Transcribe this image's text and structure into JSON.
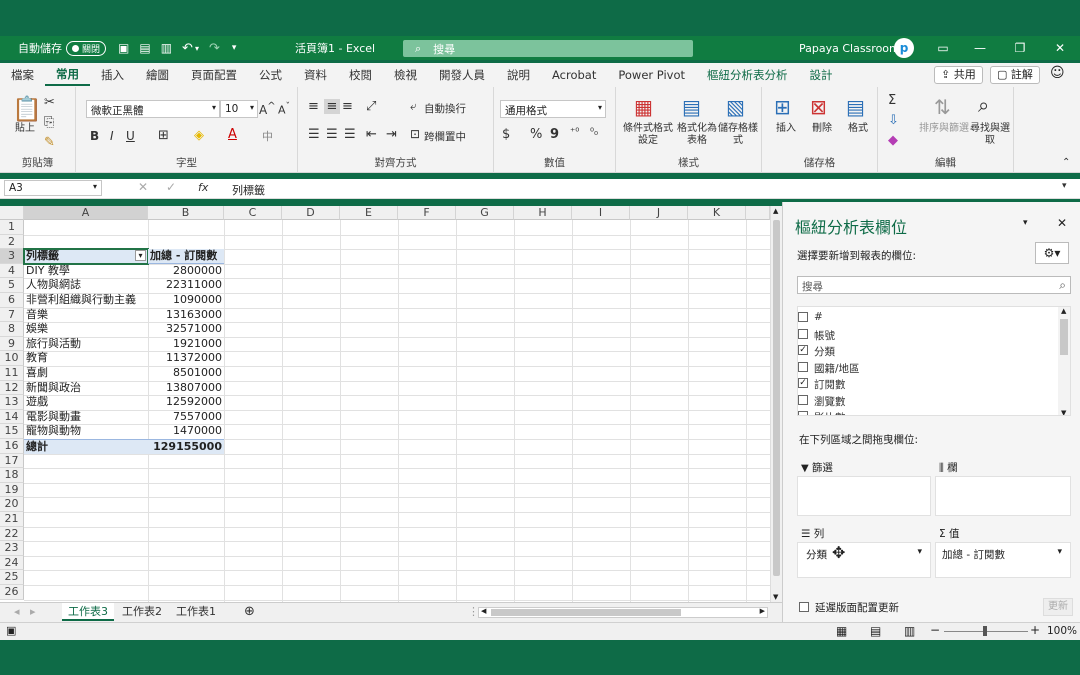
{
  "titlebar": {
    "autosave": "自動儲存",
    "toggle": "關閉",
    "doc_title": "活頁簿1 - Excel",
    "search": "搜尋",
    "user": "Papaya Classroom",
    "avatar": "p"
  },
  "tabs": [
    "檔案",
    "常用",
    "插入",
    "繪圖",
    "頁面配置",
    "公式",
    "資料",
    "校閱",
    "檢視",
    "開發人員",
    "說明",
    "Acrobat",
    "Power Pivot",
    "樞紐分析表分析",
    "設計"
  ],
  "tab_actions": {
    "share": "共用",
    "comments": "註解"
  },
  "ribbon": {
    "paste": "貼上",
    "clipboard": "剪貼簿",
    "font_name": "微軟正黑體",
    "font_size": "10",
    "font_group": "字型",
    "wrap": "自動換行",
    "merge": "跨欄置中",
    "align_group": "對齊方式",
    "num_format": "通用格式",
    "number_group": "數值",
    "cond_fmt": "條件式格式設定",
    "fmt_table": "格式化為表格",
    "cell_style": "儲存格樣式",
    "styles_group": "樣式",
    "insert": "插入",
    "delete": "刪除",
    "format": "格式",
    "cells_group": "儲存格",
    "sort": "排序與篩選",
    "find": "尋找與選取",
    "edit_group": "編輯"
  },
  "formula_bar": {
    "name_box": "A3",
    "fx": "fx",
    "content": "列標籤"
  },
  "columns": [
    "A",
    "B",
    "C",
    "D",
    "E",
    "F",
    "G",
    "H",
    "I",
    "J",
    "K"
  ],
  "rows": [
    "1",
    "2",
    "3",
    "4",
    "5",
    "6",
    "7",
    "8",
    "9",
    "10",
    "11",
    "12",
    "13",
    "14",
    "15",
    "16",
    "17",
    "18",
    "19",
    "20",
    "21",
    "22",
    "23",
    "24",
    "25",
    "26"
  ],
  "pivot": {
    "header_a": "列標籤",
    "header_b": "加總 - 訂閱數",
    "data": [
      [
        "DIY 教學",
        "2800000"
      ],
      [
        "人物與網誌",
        "22311000"
      ],
      [
        "非營利組織與行動主義",
        "1090000"
      ],
      [
        "音樂",
        "13163000"
      ],
      [
        "娛樂",
        "32571000"
      ],
      [
        "旅行與活動",
        "1921000"
      ],
      [
        "教育",
        "11372000"
      ],
      [
        "喜劇",
        "8501000"
      ],
      [
        "新聞與政治",
        "13807000"
      ],
      [
        "遊戲",
        "12592000"
      ],
      [
        "電影與動畫",
        "7557000"
      ],
      [
        "寵物與動物",
        "1470000"
      ]
    ],
    "total_label": "總計",
    "total_value": "129155000"
  },
  "sheet_tabs": [
    "工作表3",
    "工作表2",
    "工作表1"
  ],
  "pane": {
    "title": "樞紐分析表欄位",
    "choose": "選擇要新增到報表的欄位:",
    "search": "搜尋",
    "fields": [
      {
        "name": "#",
        "checked": false
      },
      {
        "name": "帳號",
        "checked": false
      },
      {
        "name": "分類",
        "checked": true
      },
      {
        "name": "國籍/地區",
        "checked": false
      },
      {
        "name": "訂閱數",
        "checked": true
      },
      {
        "name": "瀏覽數",
        "checked": false
      },
      {
        "name": "影片數",
        "checked": false
      }
    ],
    "drag_hint": "在下列區域之間拖曳欄位:",
    "filters": "篩選",
    "columns": "欄",
    "rows": "列",
    "values": "值",
    "rows_item": "分類",
    "values_item": "加總 - 訂閱數",
    "defer": "延遲版面配置更新",
    "update": "更新"
  },
  "status": {
    "zoom": "100%"
  }
}
